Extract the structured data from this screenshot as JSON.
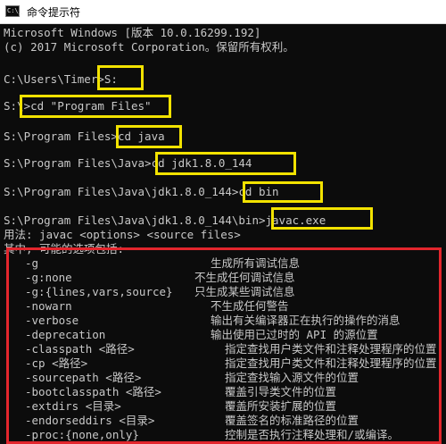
{
  "window": {
    "title": "命令提示符",
    "icon_label": "C:\\_"
  },
  "console": {
    "header1": "Microsoft Windows [版本 10.0.16299.192]",
    "header2": "(c) 2017 Microsoft Corporation。保留所有权利。",
    "prompt1": "C:\\Users\\Timer>",
    "cmd1": "S:",
    "prompt2": "S:\\>",
    "cmd2": "cd \"Program Files\"",
    "prompt3": "S:\\Program Files>",
    "cmd3": "cd java",
    "prompt4": "S:\\Program Files\\Java>",
    "cmd4": "cd jdk1.8.0_144",
    "prompt5": "S:\\Program Files\\Java\\jdk1.8.0_144>",
    "cmd5": "cd bin",
    "prompt6": "S:\\Program Files\\Java\\jdk1.8.0_144\\bin>",
    "cmd6": "javac.exe",
    "usage": "用法: javac <options> <source files>",
    "options_intro": "其中, 可能的选项包括:",
    "options": [
      {
        "opt": "-g",
        "desc": "生成所有调试信息"
      },
      {
        "opt": "-g:none",
        "desc": "不生成任何调试信息"
      },
      {
        "opt": "-g:{lines,vars,source}",
        "desc": "只生成某些调试信息"
      },
      {
        "opt": "-nowarn",
        "desc": "不生成任何警告"
      },
      {
        "opt": "-verbose",
        "desc": "输出有关编译器正在执行的操作的消息"
      },
      {
        "opt": "-deprecation",
        "desc": "输出使用已过时的 API 的源位置"
      },
      {
        "opt": "-classpath <路径>",
        "desc": "指定查找用户类文件和注释处理程序的位置"
      },
      {
        "opt": "-cp <路径>",
        "desc": "指定查找用户类文件和注释处理程序的位置"
      },
      {
        "opt": "-sourcepath <路径>",
        "desc": "指定查找输入源文件的位置"
      },
      {
        "opt": "-bootclasspath <路径>",
        "desc": "覆盖引导类文件的位置"
      },
      {
        "opt": "-extdirs <目录>",
        "desc": "覆盖所安装扩展的位置"
      },
      {
        "opt": "-endorseddirs <目录>",
        "desc": "覆盖签名的标准路径的位置"
      },
      {
        "opt": "-proc:{none,only}",
        "desc": "控制是否执行注释处理和/或编译。"
      }
    ]
  },
  "colors": {
    "console_bg": "#0c0c0c",
    "console_text": "#c8c8c8",
    "highlight_yellow": "#f2e200",
    "highlight_red": "#e3262d"
  }
}
